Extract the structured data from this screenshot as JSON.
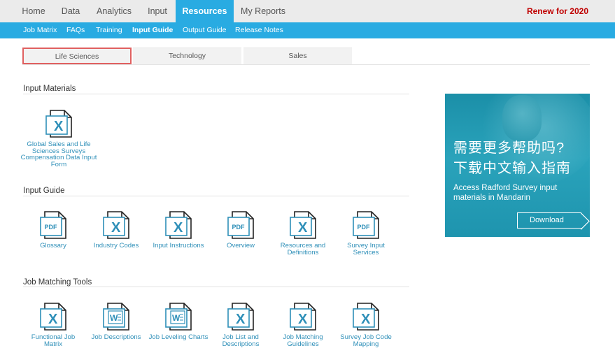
{
  "topnav": {
    "items": [
      {
        "label": "Home"
      },
      {
        "label": "Data"
      },
      {
        "label": "Analytics"
      },
      {
        "label": "Input"
      },
      {
        "label": "Resources"
      },
      {
        "label": "My Reports"
      }
    ],
    "active": "Resources",
    "renew_label": "Renew for 2020"
  },
  "subnav": {
    "items": [
      {
        "label": "Job Matrix"
      },
      {
        "label": "FAQs"
      },
      {
        "label": "Training"
      },
      {
        "label": "Input Guide"
      },
      {
        "label": "Output Guide"
      },
      {
        "label": "Release Notes"
      }
    ],
    "active": "Input Guide"
  },
  "tabs": [
    {
      "label": "Life Sciences"
    },
    {
      "label": "Technology"
    },
    {
      "label": "Sales"
    }
  ],
  "selected_tab": "Life Sciences",
  "sections": {
    "input_materials": {
      "title": "Input Materials",
      "docs": [
        {
          "label": "Global Sales and Life Sciences Surveys Compensation Data Input Form",
          "type": "excel"
        }
      ]
    },
    "input_guide": {
      "title": "Input Guide",
      "docs": [
        {
          "label": "Glossary",
          "type": "pdf"
        },
        {
          "label": "Industry Codes",
          "type": "excel"
        },
        {
          "label": "Input Instructions",
          "type": "excel"
        },
        {
          "label": "Overview",
          "type": "pdf"
        },
        {
          "label": "Resources and Definitions",
          "type": "excel"
        },
        {
          "label": "Survey Input Services",
          "type": "pdf"
        }
      ]
    },
    "job_matching": {
      "title": "Job Matching Tools",
      "docs": [
        {
          "label": "Functional Job Matrix",
          "type": "excel"
        },
        {
          "label": "Job Descriptions",
          "type": "word"
        },
        {
          "label": "Job Leveling Charts",
          "type": "word"
        },
        {
          "label": "Job List and Descriptions",
          "type": "excel"
        },
        {
          "label": "Job Matching Guidelines",
          "type": "excel"
        },
        {
          "label": "Survey Job Code Mapping",
          "type": "excel"
        }
      ]
    }
  },
  "icons": {
    "excel": {
      "glyph": "X",
      "color": "#2e8fb8"
    },
    "pdf": {
      "glyph": "PDF",
      "color": "#2e8fb8"
    },
    "word": {
      "glyph": "W",
      "color": "#2e8fb8"
    }
  },
  "ad": {
    "headline_line1": "需要更多帮助吗?",
    "headline_line2": "下载中文输入指南",
    "body": "Access Radford Survey input materials in Mandarin",
    "button_label": "Download",
    "colors": {
      "background": "#1e94ae",
      "text": "#ffffff"
    }
  },
  "colors": {
    "accent": "#29abe2",
    "link": "#2e8fb8",
    "renew": "#c00000",
    "tab_highlight": "#e06060"
  }
}
